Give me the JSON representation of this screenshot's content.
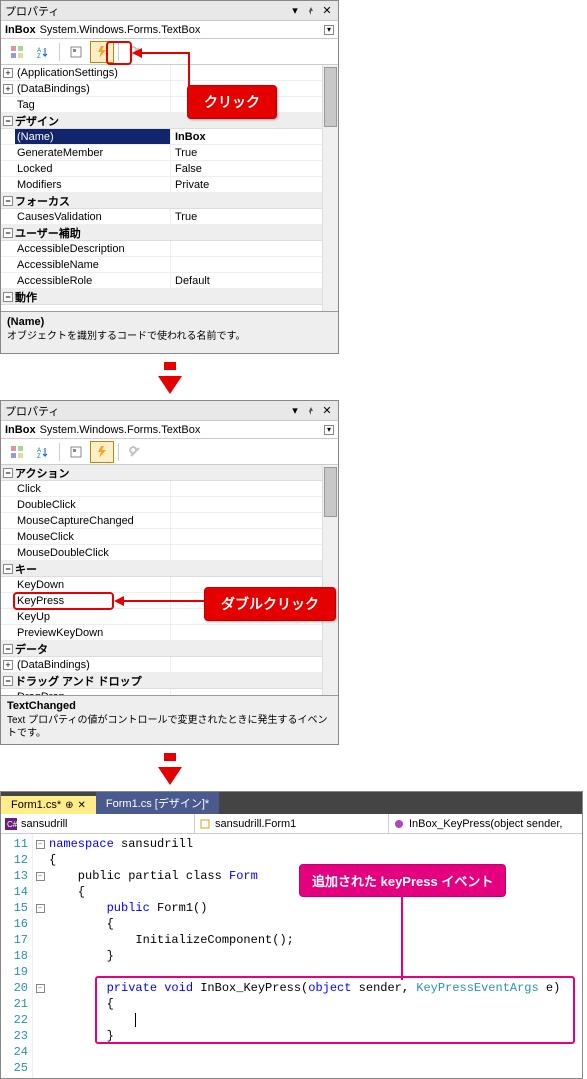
{
  "panel1": {
    "title": "プロパティ",
    "obj_name": "InBox",
    "obj_type": "System.Windows.Forms.TextBox",
    "callout": "クリック",
    "categories": [
      {
        "exp": "+",
        "name": "(ApplicationSettings)"
      },
      {
        "exp": "+",
        "name": "(DataBindings)"
      }
    ],
    "tag_row": "Tag",
    "design_cat": "デザイン",
    "design": [
      {
        "name": "(Name)",
        "val": "InBox",
        "selected": true
      },
      {
        "name": "GenerateMember",
        "val": "True"
      },
      {
        "name": "Locked",
        "val": "False"
      },
      {
        "name": "Modifiers",
        "val": "Private"
      }
    ],
    "focus_cat": "フォーカス",
    "focus": [
      {
        "name": "CausesValidation",
        "val": "True"
      }
    ],
    "user_cat": "ユーザー補助",
    "user": [
      {
        "name": "AccessibleDescription",
        "val": ""
      },
      {
        "name": "AccessibleName",
        "val": ""
      },
      {
        "name": "AccessibleRole",
        "val": "Default"
      }
    ],
    "action_cat": "動作",
    "desc_title": "(Name)",
    "desc_text": "オブジェクトを識別するコードで使われる名前です。"
  },
  "panel2": {
    "title": "プロパティ",
    "obj_name": "InBox",
    "obj_type": "System.Windows.Forms.TextBox",
    "callout": "ダブルクリック",
    "action_cat": "アクション",
    "action": [
      {
        "name": "Click"
      },
      {
        "name": "DoubleClick"
      },
      {
        "name": "MouseCaptureChanged"
      },
      {
        "name": "MouseClick"
      },
      {
        "name": "MouseDoubleClick"
      }
    ],
    "key_cat": "キー",
    "key": [
      {
        "name": "KeyDown"
      },
      {
        "name": "KeyPress",
        "hl": true
      },
      {
        "name": "KeyUp"
      },
      {
        "name": "PreviewKeyDown"
      }
    ],
    "data_cat": "データ",
    "data": [
      {
        "exp": "+",
        "name": "(DataBindings)"
      }
    ],
    "drag_cat": "ドラッグ アンド ドロップ",
    "drag": [
      {
        "name": "DragDrop"
      }
    ],
    "desc_title": "TextChanged",
    "desc_text": "Text プロパティの値がコントロールで変更されたときに発生するイベントです。"
  },
  "code": {
    "tab_active": "Form1.cs*",
    "tab_inactive": "Form1.cs [デザイン]*",
    "nav1": "sansudrill",
    "nav2": "sansudrill.Form1",
    "nav3": "InBox_KeyPress(object sender,",
    "callout": "追加された keyPress イベント",
    "lines": {
      "l11": "namespace sansudrill",
      "l12": "{",
      "l13_a": "    public partial class ",
      "l13_b": "Form",
      "l14": "    {",
      "l15_a": "        public",
      "l15_b": " Form1()",
      "l16": "        {",
      "l17": "            InitializeComponent();",
      "l18": "        }",
      "l19": "",
      "l20_a": "        private void",
      "l20_b": " InBox_KeyPress(",
      "l20_c": "object",
      "l20_d": " sender, ",
      "l20_e": "KeyPressEventArgs",
      "l20_f": " e)",
      "l21": "        {",
      "l22": "            ",
      "l23": "        }",
      "l24": "",
      "l25": ""
    }
  }
}
